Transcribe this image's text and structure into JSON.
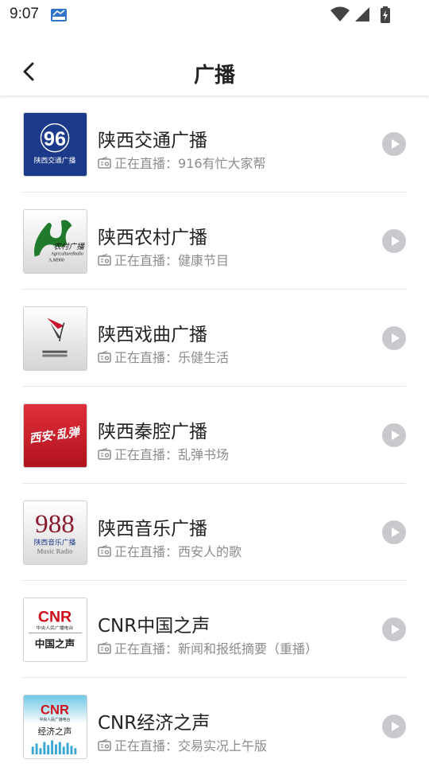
{
  "status": {
    "time": "9:07"
  },
  "header": {
    "title": "广播"
  },
  "stations": [
    {
      "name": "陕西交通广播",
      "prefix": "正在直播：",
      "program": "916有忙大家帮",
      "logo_text": "陕西交通广播",
      "logo_big": "96"
    },
    {
      "name": "陕西农村广播",
      "prefix": "正在直播：",
      "program": "健康节目",
      "logo_text": "农村广播",
      "logo_sub": "AgricultureRadio",
      "logo_freq": "A.M900"
    },
    {
      "name": "陕西戏曲广播",
      "prefix": "正在直播：",
      "program": "乐健生活"
    },
    {
      "name": "陕西秦腔广播",
      "prefix": "正在直播：",
      "program": "乱弹书场",
      "logo_text": "西安·乱弹"
    },
    {
      "name": "陕西音乐广播",
      "prefix": "正在直播：",
      "program": "西安人的歌",
      "logo_big": "988",
      "logo_text": "陕西音乐广播",
      "logo_sub": "Music Radio"
    },
    {
      "name": "CNR中国之声",
      "prefix": "正在直播：",
      "program": "新闻和报纸摘要（重播）",
      "logo_big": "CNR",
      "logo_sub": "中央人民广播电台",
      "logo_text": "中国之声"
    },
    {
      "name": "CNR经济之声",
      "prefix": "正在直播：",
      "program": "交易实况上午版",
      "logo_big": "CNR",
      "logo_sub": "中央人民广播电台",
      "logo_text": "经济之声"
    }
  ],
  "colors": {
    "accent_blue": "#1c3a8a",
    "play_button": "#c9c9cd",
    "subtitle": "#8c8c8c"
  }
}
